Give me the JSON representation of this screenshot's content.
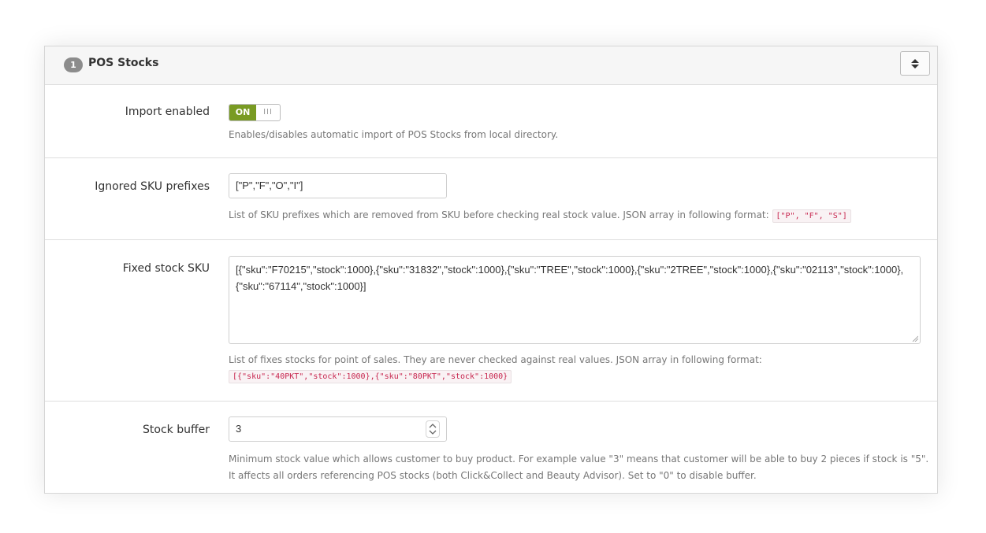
{
  "panel": {
    "badge": "1",
    "title": "POS Stocks"
  },
  "import_enabled": {
    "label": "Import enabled",
    "switch_on": "ON",
    "switch_off": "III",
    "help": "Enables/disables automatic import of POS Stocks from local directory."
  },
  "ignored_sku": {
    "label": "Ignored SKU prefixes",
    "value": "[\"P\",\"F\",\"O\",\"I\"]",
    "help": "List of SKU prefixes which are removed from SKU before checking real stock value. JSON array in following format:",
    "help_code": "[\"P\", \"F\", \"S\"]"
  },
  "fixed_stock": {
    "label": "Fixed stock SKU",
    "value": "[{\"sku\":\"F70215\",\"stock\":1000},{\"sku\":\"31832\",\"stock\":1000},{\"sku\":\"TREE\",\"stock\":1000},{\"sku\":\"2TREE\",\"stock\":1000},{\"sku\":\"02113\",\"stock\":1000},{\"sku\":\"67114\",\"stock\":1000}]",
    "help": "List of fixes stocks for point of sales. They are never checked against real values. JSON array in following format:",
    "help_code": "[{\"sku\":\"40PKT\",\"stock\":1000},{\"sku\":\"80PKT\",\"stock\":1000}"
  },
  "stock_buffer": {
    "label": "Stock buffer",
    "value": "3",
    "help_line1": "Minimum stock value which allows customer to buy product. For example value \"3\" means that customer will be able to buy 2 pieces if stock is \"5\".",
    "help_line2": "It affects all orders referencing POS stocks (both Click&Collect and Beauty Advisor). Set to \"0\" to disable buffer."
  },
  "colors": {
    "switch_on": "#799b23",
    "code_text": "#c7254e",
    "badge": "#8c8c8c"
  },
  "icons": {
    "header_toggle": "sort-arrows-icon",
    "spinner": "chevron-updown-icon"
  }
}
